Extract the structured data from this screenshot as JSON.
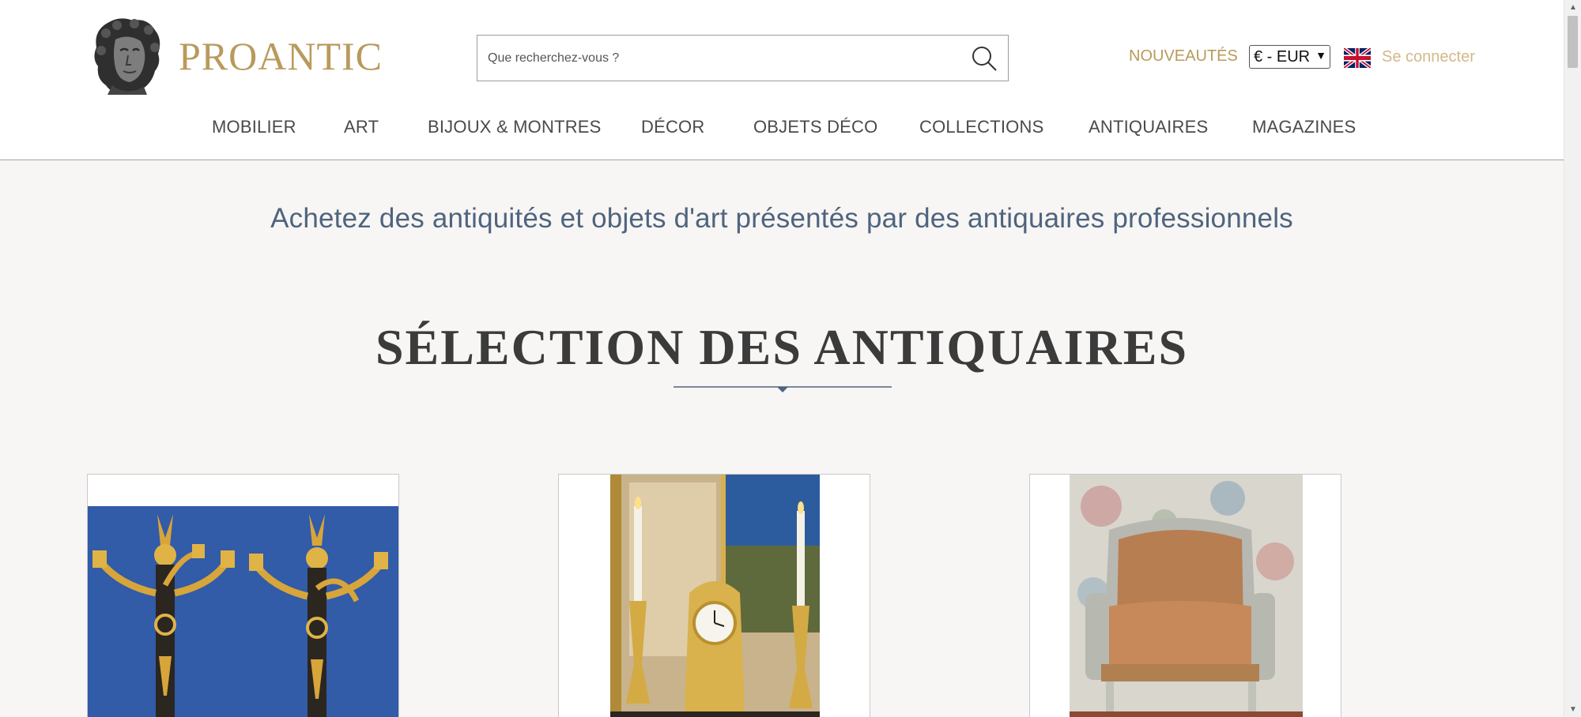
{
  "brand": {
    "name": "PROANTIC",
    "logo_icon": "classical-bust-logo"
  },
  "search": {
    "placeholder": "Que recherchez-vous ?",
    "icon": "search-icon"
  },
  "header_links": {
    "new_items": "NOUVEAUTÉS",
    "currency_selected": "€ - EUR",
    "language_flag": "uk-flag-icon",
    "login": "Se connecter"
  },
  "nav": {
    "items": [
      {
        "label": "MOBILIER"
      },
      {
        "label": "ART"
      },
      {
        "label": "BIJOUX & MONTRES"
      },
      {
        "label": "DÉCOR"
      },
      {
        "label": "OBJETS DÉCO"
      },
      {
        "label": "COLLECTIONS"
      },
      {
        "label": "ANTIQUAIRES"
      },
      {
        "label": "MAGAZINES"
      }
    ]
  },
  "main": {
    "tagline": "Achetez des antiquités et objets d'art présentés par des antiquaires professionnels",
    "section_title": "SÉLECTION DES ANTIQUAIRES"
  },
  "products": [
    {
      "image": "gilt-bronze-wall-sconces-pair"
    },
    {
      "image": "gilt-bronze-mantel-clock-with-candlesticks"
    },
    {
      "image": "painted-bergere-armchair"
    }
  ],
  "colors": {
    "gold": "#b99a5c",
    "slate_blue": "#4f647e",
    "background": "#f7f6f4"
  }
}
